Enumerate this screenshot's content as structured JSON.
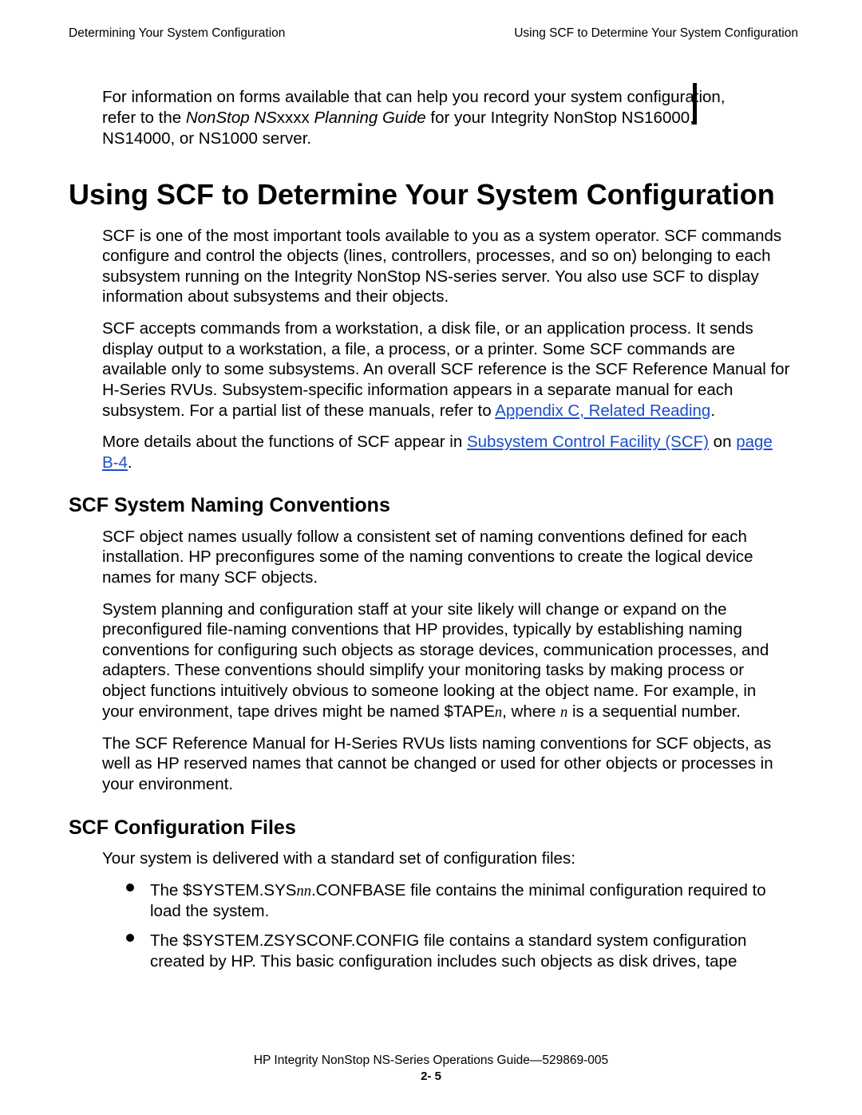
{
  "header": {
    "left": "Determining Your System Configuration",
    "right": "Using SCF to Determine Your System Configuration"
  },
  "intro": {
    "before_italic": "For information on forms available that can help you record your system configuration, refer to the ",
    "italic_1": "NonStop NS",
    "plain_mid": "xxxx",
    "italic_2": " Planning Guide",
    "after_italic": " for your Integrity NonStop NS16000, NS14000, or NS1000 server."
  },
  "h1": "Using SCF to Determine Your System Configuration",
  "p1": "SCF is one of the most important tools available to you as a system operator. SCF commands configure and control the objects (lines, controllers, processes, and so on) belonging to each subsystem running on the Integrity NonStop NS-series server. You also use SCF to display information about subsystems and their objects.",
  "p2": {
    "t1": "SCF accepts commands from a workstation, a disk file, or an application process. It sends display output to a workstation, a file, a process, or a printer. Some SCF commands are available only to some subsystems. An overall SCF reference is the ",
    "it": "SCF Reference Manual for H-Series RVUs",
    "t2": ". Subsystem-specific information appears in a separate manual for each subsystem. For a partial list of these manuals, refer to ",
    "link": "Appendix C, Related Reading",
    "t3": "."
  },
  "p3": {
    "t1": "More details about the functions of SCF appear in ",
    "link1": "Subsystem Control Facility (SCF)",
    "t2": " on ",
    "link2": "page B-4",
    "t3": "."
  },
  "h2a": "SCF System Naming Conventions",
  "p4": "SCF object names usually follow a consistent set of naming conventions defined for each installation. HP preconfigures some of the naming conventions to create the logical device names for many SCF objects.",
  "p5": {
    "t1": "System planning and configuration staff at your site likely will change or expand on the preconfigured file-naming conventions that HP provides, typically by establishing naming conventions for configuring such objects as storage devices, communication processes, and adapters. These conventions should simplify your monitoring tasks by making process or object functions intuitively obvious to someone looking at the object name. For example, in your environment, tape drives might be named $TAPE",
    "n": "n",
    "t2": ", where ",
    "n2": "n",
    "t3": " is a sequential number."
  },
  "p6": {
    "t1": "The ",
    "it": "SCF Reference Manual for H-Series RVUs",
    "t2": " lists naming conventions for SCF objects, as well as HP reserved names that cannot be changed or used for other objects or processes in your environment."
  },
  "h2b": "SCF Configuration Files",
  "p7": "Your system is delivered with a standard set of configuration files:",
  "bullets": {
    "b1": {
      "t1": "The $SYSTEM.SYS",
      "n": "nn",
      "t2": ".CONFBASE file contains the minimal configuration required to load the system."
    },
    "b2": "The $SYSTEM.ZSYSCONF.CONFIG file contains a standard system configuration created by HP.   This basic configuration includes such objects as disk drives, tape"
  },
  "footer": {
    "line": "HP Integrity NonStop NS-Series Operations Guide—529869-005",
    "page": "2- 5"
  }
}
